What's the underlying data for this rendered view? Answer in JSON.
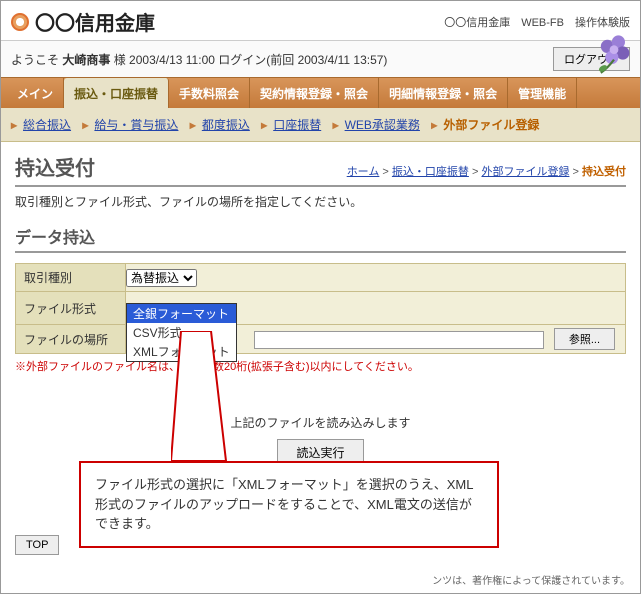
{
  "header": {
    "bank_name": "〇〇信用金庫",
    "system_title": "〇〇信用金庫　WEB-FB　操作体験版"
  },
  "welcome": {
    "prefix": "ようこそ",
    "user": "大崎商事",
    "suffix": "様 2003/4/13 11:00 ログイン(前回 2003/4/11 13:57)",
    "logout": "ログアウト"
  },
  "tabs": [
    "メイン",
    "振込・口座振替",
    "手数料照会",
    "契約情報登録・照会",
    "明細情報登録・照会",
    "管理機能"
  ],
  "subnav": {
    "items": [
      "総合振込",
      "給与・賞与振込",
      "都度振込",
      "口座振替",
      "WEB承認業務"
    ],
    "current": "外部ファイル登録"
  },
  "page": {
    "title": "持込受付",
    "instruction": "取引種別とファイル形式、ファイルの場所を指定してください。",
    "section": "データ持込"
  },
  "breadcrumb": {
    "home": "ホーム",
    "l1": "振込・口座振替",
    "l2": "外部ファイル登録",
    "cur": "持込受付"
  },
  "form": {
    "row1_label": "取引種別",
    "row1_selected": "為替振込",
    "row2_label": "ファイル形式",
    "row2_options": [
      "全銀フォーマット",
      "CSV形式",
      "XMLフォーマット"
    ],
    "row3_label": "ファイルの場所",
    "browse": "参照...",
    "note": "※外部ファイルのファイル名は、半角英数20桁(拡張子含む)以内にしてください。"
  },
  "action": {
    "label": "上記のファイルを読み込みします",
    "button": "読込実行"
  },
  "top_button": "TOP",
  "callout": "ファイル形式の選択に「XMLフォーマット」を選択のうえ、XML形式のファイルのアップロードをすることで、XML電文の送信ができます。",
  "footer": "ンツは、著作権によって保護されています。"
}
